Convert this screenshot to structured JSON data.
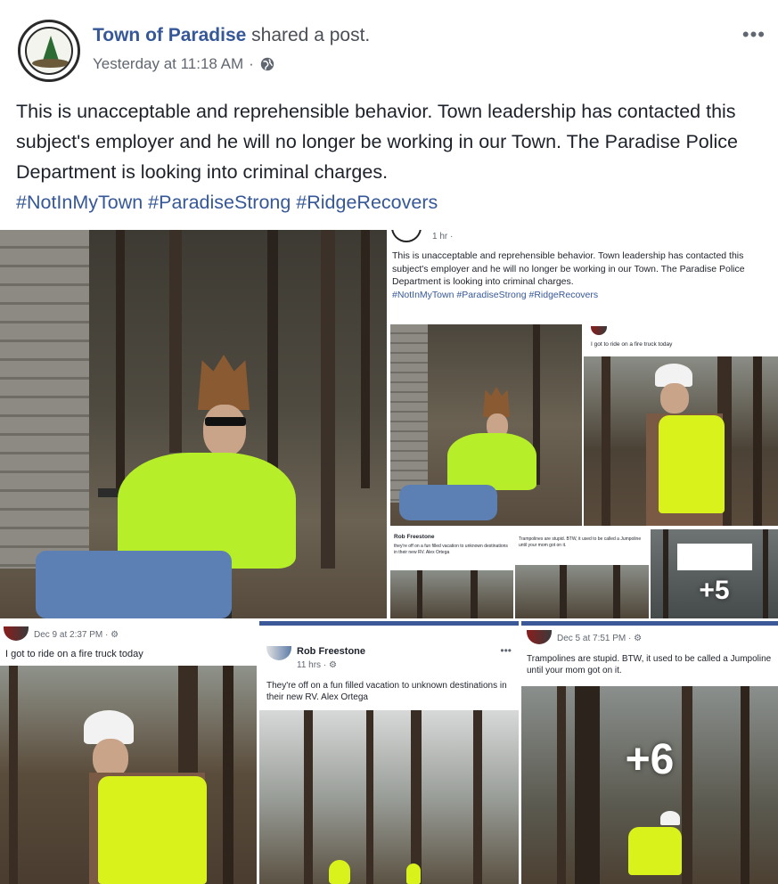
{
  "post": {
    "author": "Town of Paradise",
    "action": "shared a post.",
    "timestamp": "Yesterday at 11:18 AM",
    "separator": "·",
    "privacy_icon": "globe-icon",
    "more_icon": "•••",
    "text": "This is unacceptable and reprehensible behavior. Town leadership has contacted this subject's employer and he will no longer be working in our Town. The Paradise Police Department is looking into criminal charges.",
    "hashtags": "#NotInMyTown #ParadiseStrong #RidgeRecovers"
  },
  "shared_screenshot": {
    "time": "1 hr ·",
    "text": "This is unacceptable and reprehensible behavior. Town leadership has contacted this subject's employer and he will no longer be working in our Town. The Paradise Police Department is looking into criminal charges.",
    "hashtags": "#NotInMyTown #ParadiseStrong #RidgeRecovers",
    "mini_fire_truck_caption": "I got to ride on a fire truck today",
    "mini_rob_name": "Rob Freestone",
    "mini_rob_caption": "they're off on a fun filled vacation to unknown destinations in their new RV. Alex Ortega",
    "mini_trampoline_caption": "Trampolines are stupid. BTW, it used to be called a Jumpoline until your mom got on it.",
    "overlay_count": "+5"
  },
  "cards": {
    "fire_truck": {
      "meta": "Dec 9 at 2:37 PM · ⚙",
      "caption": "I got to ride on a fire truck today"
    },
    "rob": {
      "author": "Rob Freestone",
      "meta": "11 hrs · ⚙",
      "caption": "They're off on a fun filled vacation to unknown destinations in their new RV. Alex Ortega",
      "more": "•••"
    },
    "trampoline": {
      "meta": "Dec 5 at 7:51 PM · ⚙",
      "caption": "Trampolines are stupid. BTW, it used to be called a Jumpoline until your mom got on it.",
      "overlay_count": "+6"
    }
  },
  "colors": {
    "link_blue": "#365899",
    "hi_vis_yellow": "#b6ef2a",
    "facebook_blue": "#3b5998"
  }
}
